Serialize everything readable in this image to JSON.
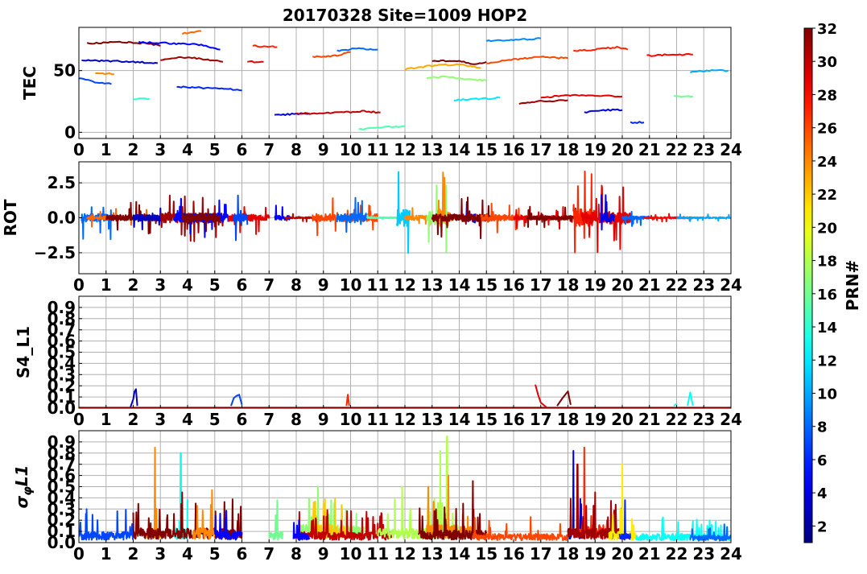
{
  "figure": {
    "title": "20170328 Site=1009 HOP2"
  },
  "chart_data": [
    {
      "type": "line",
      "ylabel": "TEC",
      "xlim": [
        0,
        24
      ],
      "ylim": [
        -5,
        85
      ],
      "xticks": [
        0,
        1,
        2,
        3,
        4,
        5,
        6,
        7,
        8,
        9,
        10,
        11,
        12,
        13,
        14,
        15,
        16,
        17,
        18,
        19,
        20,
        21,
        22,
        23,
        24
      ],
      "yticks": [
        0,
        50
      ],
      "ytick_labels": [
        "0",
        "50"
      ],
      "grid": true,
      "series": [
        {
          "prn": 3,
          "x": [
            0.1,
            1.0,
            2.0,
            2.9
          ],
          "y": [
            58,
            58,
            57,
            56
          ]
        },
        {
          "prn": 32,
          "x": [
            0.3,
            1.5,
            2.5,
            3.0
          ],
          "y": [
            72,
            73,
            72,
            70
          ]
        },
        {
          "prn": 5,
          "x": [
            2.2,
            3.5,
            4.5,
            5.2
          ],
          "y": [
            73,
            72,
            71,
            67
          ]
        },
        {
          "prn": 31,
          "x": [
            3.0,
            4.0,
            5.0,
            5.3
          ],
          "y": [
            59,
            61,
            58,
            57
          ]
        },
        {
          "prn": 25,
          "x": [
            3.8,
            4.5
          ],
          "y": [
            80,
            82
          ]
        },
        {
          "prn": 7,
          "x": [
            0.0,
            0.5,
            1.2
          ],
          "y": [
            44,
            41,
            39
          ]
        },
        {
          "prn": 24,
          "x": [
            0.6,
            1.3
          ],
          "y": [
            48,
            47
          ]
        },
        {
          "prn": 6,
          "x": [
            3.6,
            4.5,
            5.5,
            6.0
          ],
          "y": [
            37,
            36,
            35,
            34
          ]
        },
        {
          "prn": 14,
          "x": [
            2.0,
            2.6
          ],
          "y": [
            27,
            27
          ]
        },
        {
          "prn": 27,
          "x": [
            6.4,
            7.3
          ],
          "y": [
            70,
            69
          ]
        },
        {
          "prn": 29,
          "x": [
            6.2,
            6.8
          ],
          "y": [
            57,
            57
          ]
        },
        {
          "prn": 4,
          "x": [
            7.2,
            8.0,
            8.5
          ],
          "y": [
            14,
            15,
            15
          ]
        },
        {
          "prn": 30,
          "x": [
            8.0,
            9.5,
            10.5,
            11.1
          ],
          "y": [
            15,
            16,
            17,
            16
          ]
        },
        {
          "prn": 26,
          "x": [
            8.6,
            9.5,
            10.0
          ],
          "y": [
            61,
            62,
            65
          ]
        },
        {
          "prn": 8,
          "x": [
            9.5,
            10.3,
            11.0
          ],
          "y": [
            66,
            68,
            67
          ]
        },
        {
          "prn": 15,
          "x": [
            10.3,
            11.0,
            12.0
          ],
          "y": [
            2,
            4,
            5
          ]
        },
        {
          "prn": 23,
          "x": [
            12.0,
            13.0,
            14.0,
            14.8
          ],
          "y": [
            51,
            54,
            55,
            52
          ]
        },
        {
          "prn": 17,
          "x": [
            12.8,
            13.5,
            14.2,
            15.0
          ],
          "y": [
            44,
            45,
            43,
            42
          ]
        },
        {
          "prn": 32,
          "x": [
            13.0,
            14.0,
            14.5,
            15.0
          ],
          "y": [
            58,
            58,
            55,
            57
          ]
        },
        {
          "prn": 12,
          "x": [
            13.8,
            14.8,
            15.5
          ],
          "y": [
            26,
            27,
            28
          ]
        },
        {
          "prn": 26,
          "x": [
            15.0,
            16.0,
            17.0,
            18.0
          ],
          "y": [
            56,
            59,
            61,
            60
          ]
        },
        {
          "prn": 9,
          "x": [
            15.0,
            16.0,
            17.0
          ],
          "y": [
            74,
            75,
            76
          ]
        },
        {
          "prn": 31,
          "x": [
            16.2,
            17.0,
            18.0
          ],
          "y": [
            23,
            25,
            26
          ]
        },
        {
          "prn": 29,
          "x": [
            17.0,
            18.0,
            19.0,
            20.0
          ],
          "y": [
            28,
            30,
            30,
            29
          ]
        },
        {
          "prn": 27,
          "x": [
            18.2,
            19.0,
            19.8,
            20.2
          ],
          "y": [
            66,
            67,
            69,
            67
          ]
        },
        {
          "prn": 4,
          "x": [
            18.6,
            19.3,
            20.0
          ],
          "y": [
            16,
            18,
            18
          ]
        },
        {
          "prn": 6,
          "x": [
            20.3,
            20.8
          ],
          "y": [
            8,
            8
          ]
        },
        {
          "prn": 28,
          "x": [
            20.9,
            21.8,
            22.6
          ],
          "y": [
            62,
            63,
            63
          ]
        },
        {
          "prn": 16,
          "x": [
            21.9,
            22.6
          ],
          "y": [
            29,
            29
          ]
        },
        {
          "prn": 10,
          "x": [
            22.5,
            23.2,
            23.9
          ],
          "y": [
            49,
            50,
            50
          ]
        }
      ]
    },
    {
      "type": "line",
      "ylabel": "ROT",
      "xlim": [
        0,
        24
      ],
      "ylim": [
        -4,
        4
      ],
      "xticks": [
        0,
        1,
        2,
        3,
        4,
        5,
        6,
        7,
        8,
        9,
        10,
        11,
        12,
        13,
        14,
        15,
        16,
        17,
        18,
        19,
        20,
        21,
        22,
        23,
        24
      ],
      "yticks": [
        2.5,
        0,
        -2.5
      ],
      "ytick_labels": [
        "2.5",
        "0.0",
        "−2.5"
      ],
      "grid": true,
      "series": [
        {
          "prn": 8,
          "x0": 0.1,
          "x1": 1.2,
          "amp": 1.6,
          "seed": 1
        },
        {
          "prn": 25,
          "x0": 0.3,
          "x1": 2.8,
          "amp": 0.7,
          "seed": 2
        },
        {
          "prn": 32,
          "x0": 1.0,
          "x1": 3.0,
          "amp": 1.2,
          "seed": 3
        },
        {
          "prn": 3,
          "x0": 2.0,
          "x1": 3.2,
          "amp": 1.3,
          "seed": 4
        },
        {
          "prn": 31,
          "x0": 3.0,
          "x1": 5.3,
          "amp": 2.0,
          "seed": 5
        },
        {
          "prn": 5,
          "x0": 3.5,
          "x1": 5.5,
          "amp": 1.8,
          "seed": 6
        },
        {
          "prn": 32,
          "x0": 3.8,
          "x1": 5.2,
          "amp": 1.6,
          "seed": 7
        },
        {
          "prn": 29,
          "x0": 5.5,
          "x1": 7.0,
          "amp": 1.3,
          "seed": 8
        },
        {
          "prn": 7,
          "x0": 5.7,
          "x1": 6.2,
          "amp": 1.8,
          "seed": 9
        },
        {
          "prn": 5,
          "x0": 7.2,
          "x1": 7.8,
          "amp": 0.9,
          "seed": 10
        },
        {
          "prn": 30,
          "x0": 7.6,
          "x1": 8.9,
          "amp": 0.3,
          "seed": 11
        },
        {
          "prn": 26,
          "x0": 8.6,
          "x1": 11.0,
          "amp": 1.5,
          "seed": 12
        },
        {
          "prn": 8,
          "x0": 9.5,
          "x1": 10.6,
          "amp": 1.9,
          "seed": 13
        },
        {
          "prn": 15,
          "x0": 10.6,
          "x1": 12.0,
          "amp": 0.3,
          "seed": 14
        },
        {
          "prn": 11,
          "x0": 11.7,
          "x1": 12.2,
          "amp": 3.5,
          "seed": 15
        },
        {
          "prn": 24,
          "x0": 12.0,
          "x1": 13.8,
          "amp": 1.0,
          "seed": 16
        },
        {
          "prn": 17,
          "x0": 12.8,
          "x1": 13.6,
          "amp": 3.0,
          "seed": 17
        },
        {
          "prn": 24,
          "x0": 13.2,
          "x1": 13.7,
          "amp": 3.5,
          "seed": 18
        },
        {
          "prn": 5,
          "x0": 14.2,
          "x1": 14.6,
          "amp": 2.0,
          "seed": 19
        },
        {
          "prn": 32,
          "x0": 13.0,
          "x1": 15.2,
          "amp": 1.5,
          "seed": 20
        },
        {
          "prn": 26,
          "x0": 14.8,
          "x1": 16.3,
          "amp": 1.2,
          "seed": 21
        },
        {
          "prn": 29,
          "x0": 16.0,
          "x1": 18.0,
          "amp": 0.8,
          "seed": 22
        },
        {
          "prn": 32,
          "x0": 16.5,
          "x1": 18.3,
          "amp": 0.8,
          "seed": 23
        },
        {
          "prn": 27,
          "x0": 18.2,
          "x1": 19.0,
          "amp": 3.5,
          "seed": 24
        },
        {
          "prn": 29,
          "x0": 18.5,
          "x1": 20.3,
          "amp": 2.5,
          "seed": 25
        },
        {
          "prn": 4,
          "x0": 19.2,
          "x1": 19.7,
          "amp": 1.8,
          "seed": 26
        },
        {
          "prn": 8,
          "x0": 20.0,
          "x1": 21.0,
          "amp": 0.6,
          "seed": 27
        },
        {
          "prn": 28,
          "x0": 20.8,
          "x1": 22.6,
          "amp": 0.3,
          "seed": 28
        },
        {
          "prn": 10,
          "x0": 22.0,
          "x1": 24.0,
          "amp": 0.25,
          "seed": 29
        }
      ]
    },
    {
      "type": "line",
      "ylabel": "S4_L1",
      "xlim": [
        0,
        24
      ],
      "ylim": [
        0,
        1
      ],
      "xticks": [
        0,
        1,
        2,
        3,
        4,
        5,
        6,
        7,
        8,
        9,
        10,
        11,
        12,
        13,
        14,
        15,
        16,
        17,
        18,
        19,
        20,
        21,
        22,
        23,
        24
      ],
      "yticks": [
        0.0,
        0.1,
        0.2,
        0.3,
        0.4,
        0.5,
        0.6,
        0.7,
        0.8,
        0.9
      ],
      "ytick_labels": [
        "0.0",
        "0.1",
        "0.2",
        "0.3",
        "0.4",
        "0.5",
        "0.6",
        "0.7",
        "0.8",
        "0.9"
      ],
      "grid": true,
      "series": [
        {
          "prn": 28,
          "x": [
            0,
            24
          ],
          "y": [
            0.005,
            0.005
          ]
        },
        {
          "prn": 3,
          "x": [
            1.9,
            2.0,
            2.05,
            2.1,
            2.15
          ],
          "y": [
            0.01,
            0.08,
            0.15,
            0.17,
            0.02
          ]
        },
        {
          "prn": 7,
          "x": [
            5.6,
            5.7,
            5.8,
            5.9,
            6.0
          ],
          "y": [
            0.02,
            0.09,
            0.11,
            0.12,
            0.03
          ]
        },
        {
          "prn": 27,
          "x": [
            9.85,
            9.9,
            9.95
          ],
          "y": [
            0.02,
            0.12,
            0.02
          ]
        },
        {
          "prn": 29,
          "x": [
            16.8,
            16.9,
            17.0,
            17.2
          ],
          "y": [
            0.21,
            0.12,
            0.05,
            0.01
          ]
        },
        {
          "prn": 32,
          "x": [
            17.6,
            17.8,
            18.0,
            18.1
          ],
          "y": [
            0.02,
            0.09,
            0.15,
            0.03
          ]
        },
        {
          "prn": 13,
          "x": [
            22.4,
            22.5,
            22.6
          ],
          "y": [
            0.02,
            0.14,
            0.02
          ]
        },
        {
          "prn": 13,
          "x": [
            21.9,
            22.0
          ],
          "y": [
            0.02,
            0.04
          ]
        }
      ]
    },
    {
      "type": "line",
      "ylabel": "σ_φL1",
      "xlim": [
        0,
        24
      ],
      "ylim": [
        0,
        1
      ],
      "xticks": [
        0,
        1,
        2,
        3,
        4,
        5,
        6,
        7,
        8,
        9,
        10,
        11,
        12,
        13,
        14,
        15,
        16,
        17,
        18,
        19,
        20,
        21,
        22,
        23,
        24
      ],
      "yticks": [
        0.0,
        0.1,
        0.2,
        0.3,
        0.4,
        0.5,
        0.6,
        0.7,
        0.8,
        0.9
      ],
      "ytick_labels": [
        "0.0",
        "0.1",
        "0.2",
        "0.3",
        "0.4",
        "0.5",
        "0.6",
        "0.7",
        "0.8",
        "0.9"
      ],
      "grid": true,
      "series": [
        {
          "prn": 7,
          "x0": 0.0,
          "x1": 2.0,
          "base": 0.06,
          "seed": 31
        },
        {
          "prn": 24,
          "x0": 2.5,
          "x1": 3.0,
          "base": 0.08,
          "seed": 32,
          "peaks": [
            [
              2.8,
              0.85
            ]
          ]
        },
        {
          "prn": 13,
          "x0": 3.5,
          "x1": 4.0,
          "base": 0.08,
          "seed": 33,
          "peaks": [
            [
              3.75,
              0.8
            ]
          ]
        },
        {
          "prn": 32,
          "x0": 2.0,
          "x1": 6.0,
          "base": 0.08,
          "seed": 34,
          "peaks": [
            [
              3.8,
              0.45
            ],
            [
              4.3,
              0.35
            ]
          ]
        },
        {
          "prn": 24,
          "x0": 4.2,
          "x1": 5.0,
          "base": 0.08,
          "seed": 35,
          "peaks": [
            [
              4.9,
              0.47
            ]
          ]
        },
        {
          "prn": 5,
          "x0": 5.0,
          "x1": 6.0,
          "base": 0.06,
          "seed": 36
        },
        {
          "prn": 16,
          "x0": 7.0,
          "x1": 7.5,
          "base": 0.06,
          "seed": 37,
          "peaks": [
            [
              7.3,
              0.38
            ]
          ]
        },
        {
          "prn": 17,
          "x0": 8.0,
          "x1": 10.5,
          "base": 0.1,
          "seed": 38,
          "peaks": [
            [
              8.8,
              0.5
            ],
            [
              9.4,
              0.35
            ]
          ]
        },
        {
          "prn": 22,
          "x0": 8.6,
          "x1": 9.8,
          "base": 0.1,
          "seed": 39,
          "peaks": [
            [
              9.0,
              0.35
            ]
          ]
        },
        {
          "prn": 30,
          "x0": 8.0,
          "x1": 11.5,
          "base": 0.06,
          "seed": 40
        },
        {
          "prn": 5,
          "x0": 7.9,
          "x1": 8.5,
          "base": 0.05,
          "seed": 41,
          "peaks": [
            [
              8.1,
              0.2
            ]
          ]
        },
        {
          "prn": 18,
          "x0": 11.0,
          "x1": 13.0,
          "base": 0.08,
          "seed": 42,
          "peaks": [
            [
              11.9,
              0.5
            ]
          ]
        },
        {
          "prn": 18,
          "x0": 12.8,
          "x1": 14.0,
          "base": 0.1,
          "seed": 43,
          "peaks": [
            [
              13.3,
              0.82
            ],
            [
              13.55,
              0.95
            ]
          ]
        },
        {
          "prn": 24,
          "x0": 12.8,
          "x1": 14.5,
          "base": 0.1,
          "seed": 44,
          "peaks": [
            [
              13.6,
              0.6
            ]
          ]
        },
        {
          "prn": 32,
          "x0": 12.5,
          "x1": 15.0,
          "base": 0.07,
          "seed": 45,
          "peaks": [
            [
              14.5,
              0.55
            ]
          ]
        },
        {
          "prn": 26,
          "x0": 14.5,
          "x1": 18.0,
          "base": 0.05,
          "seed": 46
        },
        {
          "prn": 3,
          "x0": 18.0,
          "x1": 18.5,
          "base": 0.08,
          "seed": 47,
          "peaks": [
            [
              18.2,
              0.82
            ]
          ]
        },
        {
          "prn": 27,
          "x0": 18.3,
          "x1": 19.5,
          "base": 0.1,
          "seed": 48,
          "peaks": [
            [
              18.6,
              0.85
            ]
          ]
        },
        {
          "prn": 31,
          "x0": 18.0,
          "x1": 20.0,
          "base": 0.08,
          "seed": 49,
          "peaks": [
            [
              18.35,
              0.7
            ],
            [
              19.0,
              0.45
            ]
          ]
        },
        {
          "prn": 21,
          "x0": 19.5,
          "x1": 20.5,
          "base": 0.06,
          "seed": 50,
          "peaks": [
            [
              20.0,
              0.7
            ]
          ]
        },
        {
          "prn": 6,
          "x0": 19.9,
          "x1": 20.3,
          "base": 0.05,
          "seed": 51,
          "peaks": [
            [
              20.1,
              0.38
            ]
          ]
        },
        {
          "prn": 13,
          "x0": 20.5,
          "x1": 24.0,
          "base": 0.05,
          "seed": 52
        },
        {
          "prn": 8,
          "x0": 22.5,
          "x1": 24.0,
          "base": 0.04,
          "seed": 53
        }
      ]
    }
  ],
  "colorbar": {
    "label": "PRN#",
    "min": 1,
    "max": 32,
    "ticks": [
      2,
      4,
      6,
      8,
      10,
      12,
      14,
      16,
      18,
      20,
      22,
      24,
      26,
      28,
      30,
      32
    ],
    "colormap": "jet"
  }
}
